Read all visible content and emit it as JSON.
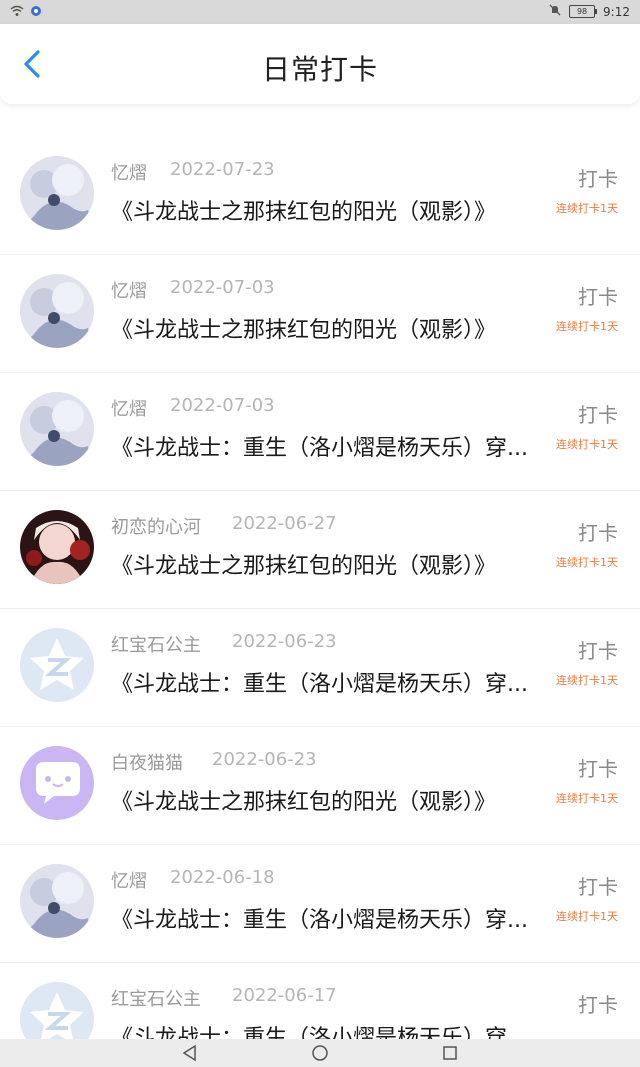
{
  "status": {
    "battery": "98",
    "time": "9:12"
  },
  "header": {
    "title": "日常打卡"
  },
  "colors": {
    "accent": "#2d8cf0",
    "streak": "#ef7a3b",
    "statusbar": "#d9d9d9"
  },
  "icons": {
    "back": "chevron-left-icon",
    "wifi": "wifi-icon",
    "app": "app-indicator-icon",
    "mute": "bell-off-icon",
    "battery": "battery-icon",
    "nav_back": "triangle-back-icon",
    "nav_home": "circle-home-icon",
    "nav_recent": "square-recent-icon"
  },
  "items": [
    {
      "name": "忆熠",
      "date": "2022-07-23",
      "book": "《斗龙战士之那抹红包的阳光（观影）》",
      "checkin": "打卡",
      "streak": "连续打卡1天",
      "avatar": "anime-girl-avatar"
    },
    {
      "name": "忆熠",
      "date": "2022-07-03",
      "book": "《斗龙战士之那抹红包的阳光（观影）》",
      "checkin": "打卡",
      "streak": "连续打卡1天",
      "avatar": "anime-girl-avatar"
    },
    {
      "name": "忆熠",
      "date": "2022-07-03",
      "book": "《斗龙战士：重生（洛小熠是杨天乐）穿...",
      "checkin": "打卡",
      "streak": "连续打卡1天",
      "avatar": "anime-girl-avatar"
    },
    {
      "name": "初恋的心河",
      "date": "2022-06-27",
      "book": "《斗龙战士之那抹红包的阳光（观影）》",
      "checkin": "打卡",
      "streak": "连续打卡1天",
      "avatar": "red-anime-avatar"
    },
    {
      "name": "红宝石公主",
      "date": "2022-06-23",
      "book": "《斗龙战士：重生（洛小熠是杨天乐）穿...",
      "checkin": "打卡",
      "streak": "连续打卡1天",
      "avatar": "qzone-star-avatar"
    },
    {
      "name": "白夜猫猫",
      "date": "2022-06-23",
      "book": "《斗龙战士之那抹红包的阳光（观影）》",
      "checkin": "打卡",
      "streak": "连续打卡1天",
      "avatar": "chat-bubble-avatar"
    },
    {
      "name": "忆熠",
      "date": "2022-06-18",
      "book": "《斗龙战士：重生（洛小熠是杨天乐）穿...",
      "checkin": "打卡",
      "streak": "连续打卡1天",
      "avatar": "anime-girl-avatar"
    },
    {
      "name": "红宝石公主",
      "date": "2022-06-17",
      "book": "《斗龙战士：重生（洛小熠是杨天乐）穿...",
      "checkin": "打卡",
      "streak": "",
      "avatar": "qzone-star-avatar"
    }
  ]
}
